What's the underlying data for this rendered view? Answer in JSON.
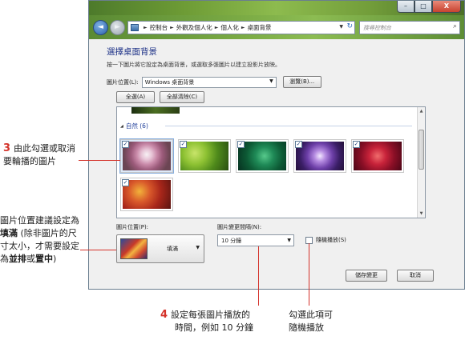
{
  "window": {
    "titlebar_buttons": {
      "minimize": "–",
      "maximize": "□",
      "close": "X"
    },
    "nav": {
      "back": "◄",
      "forward": "►"
    },
    "breadcrumbs": [
      "控制台",
      "外觀及個人化",
      "個人化",
      "桌面背景"
    ],
    "search_placeholder": "搜尋控制台"
  },
  "content": {
    "title": "選擇桌面背景",
    "instruction": "按一下圖片將它設定為桌面背景，或選取多張圖片以建立投影片放映。",
    "location_label": "圖片位置(L):",
    "location_value": "Windows 桌面背景",
    "browse_button": "瀏覽(B)...",
    "select_all_button": "全選(A)",
    "clear_all_button": "全部清除(C)",
    "group_name": "自然 (6)",
    "position_label": "圖片位置(P):",
    "position_value": "填滿",
    "interval_label": "圖片變更間隔(N):",
    "interval_value": "10 分鐘",
    "shuffle_label": "隨機播放(S)",
    "save_button": "儲存變更",
    "cancel_button": "取消"
  },
  "thumbnails": [
    {
      "name": "pink-flower",
      "checked": "✓"
    },
    {
      "name": "green-leaves",
      "checked": "✓"
    },
    {
      "name": "green-plant",
      "checked": "✓"
    },
    {
      "name": "purple-flower",
      "checked": "✓"
    },
    {
      "name": "red-flower",
      "checked": "✓"
    },
    {
      "name": "red-leaves",
      "checked": "✓"
    }
  ],
  "annotations": {
    "a3": {
      "num": "3",
      "text": "由此勾選或取消要輪播的圖片"
    },
    "a_pos": {
      "text1": "圖片位置建議設定為",
      "fill": "填滿",
      "text2": " (除非圖片的尺寸太小，才需要設定為",
      "tile": "並排",
      "or": "或",
      "center": "置中",
      "end": ")"
    },
    "a4": {
      "num": "4",
      "line1": "設定每張圖片播放的",
      "line2": "時間，例如 10 分鐘"
    },
    "a_shuffle": {
      "line1": "勾選此項可",
      "line2": "隨機播放"
    }
  },
  "colors": {
    "accent": "#1e3287",
    "annotation": "#d4322a"
  }
}
